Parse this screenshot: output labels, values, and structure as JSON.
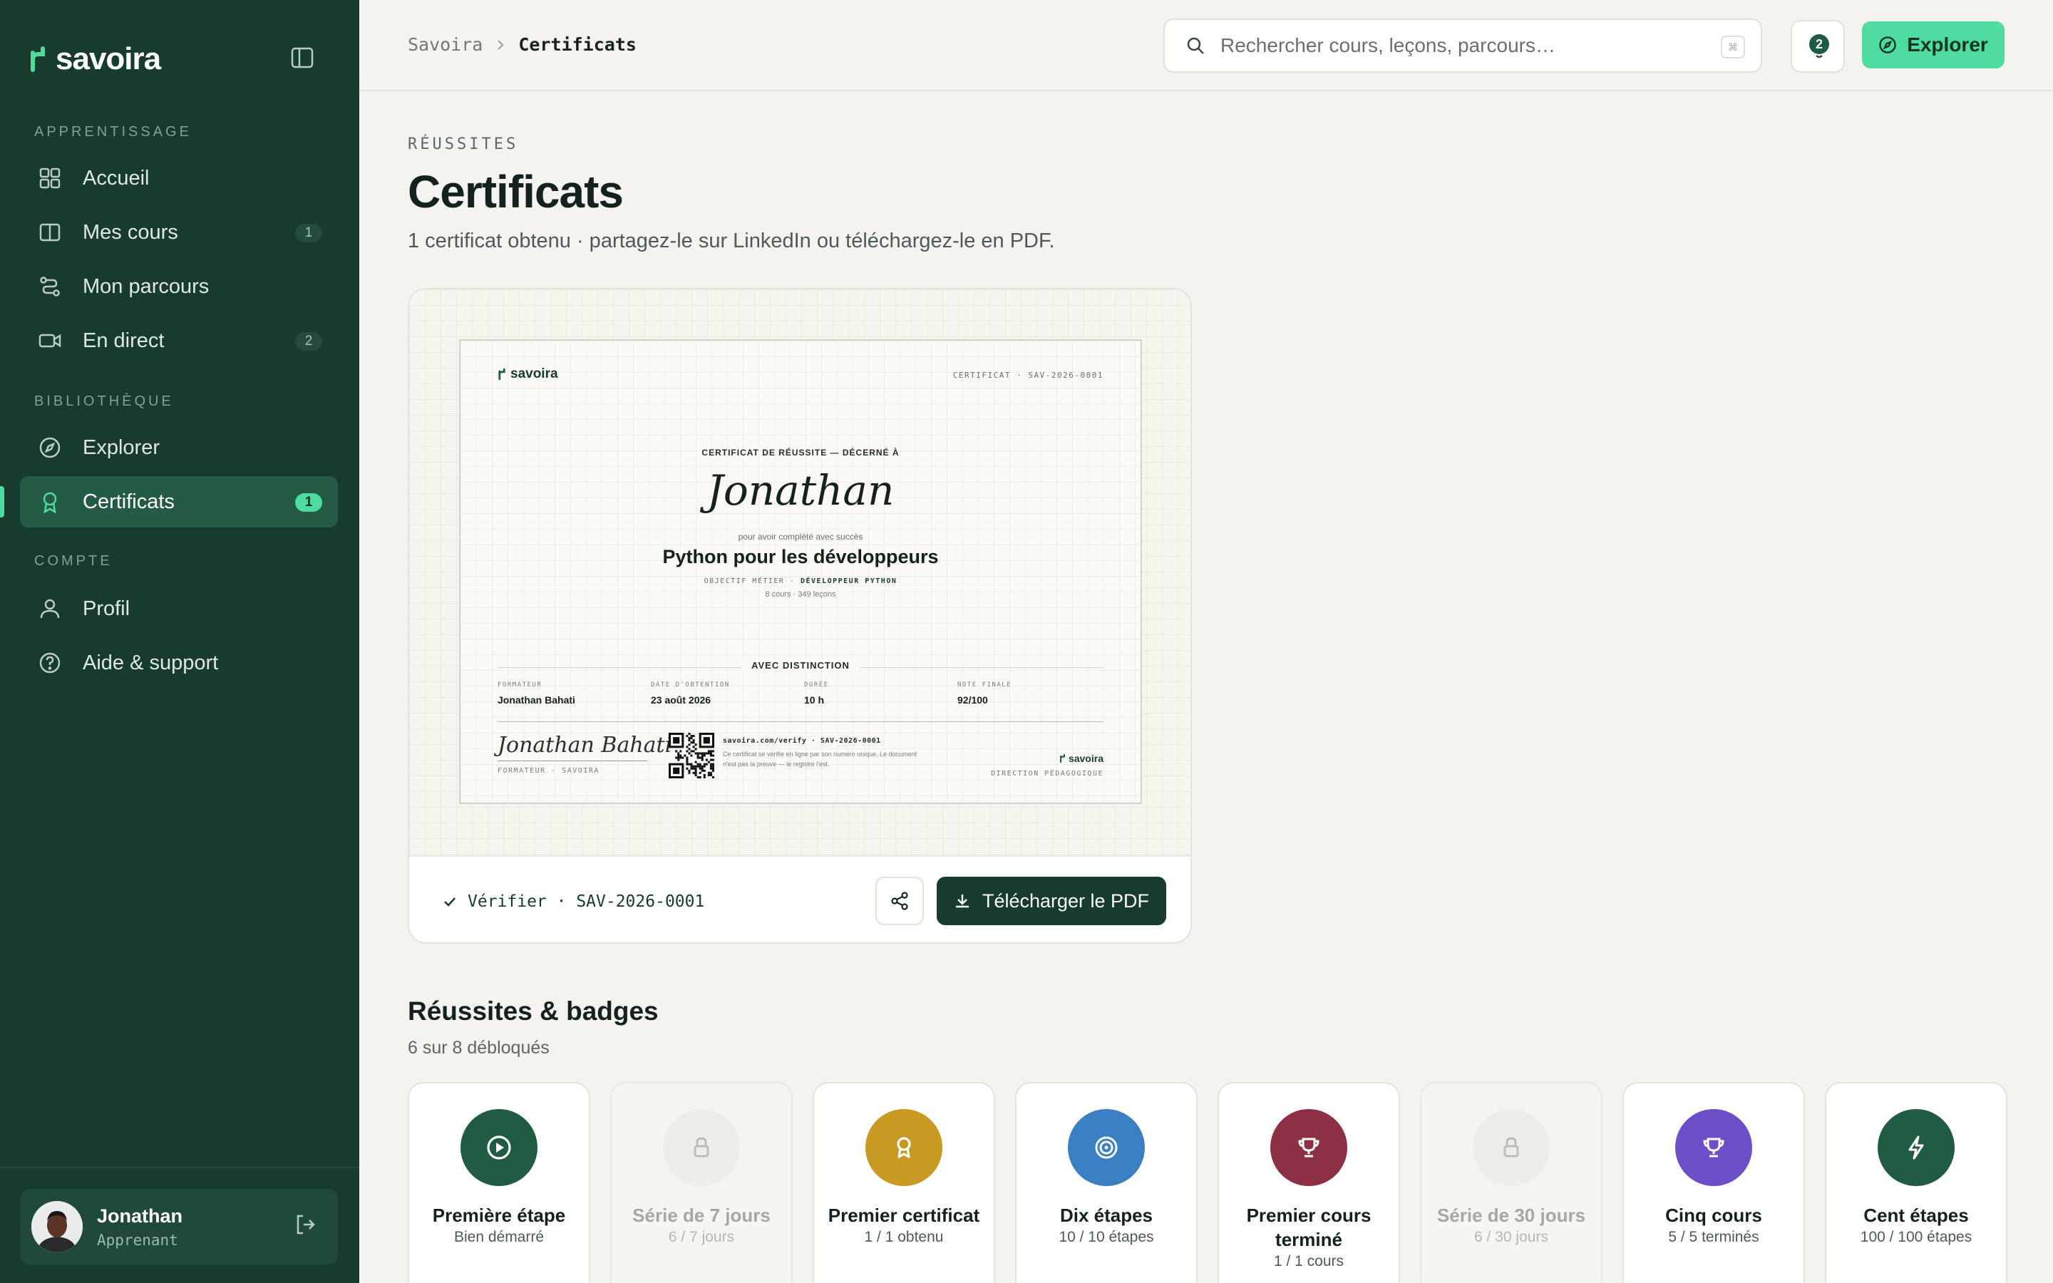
{
  "app": {
    "brand": "savoira"
  },
  "sidebar": {
    "sections": [
      {
        "label": "APPRENTISSAGE"
      },
      {
        "label": "BIBLIOTHÈQUE"
      },
      {
        "label": "COMPTE"
      }
    ],
    "items": [
      {
        "label": "Accueil",
        "icon": "grid-icon"
      },
      {
        "label": "Mes cours",
        "icon": "book-icon",
        "count": "1"
      },
      {
        "label": "Mon parcours",
        "icon": "route-icon"
      },
      {
        "label": "En direct",
        "icon": "video-icon",
        "count": "2"
      },
      {
        "label": "Explorer",
        "icon": "compass-icon"
      },
      {
        "label": "Certificats",
        "icon": "award-icon",
        "count": "1",
        "active": true
      },
      {
        "label": "Profil",
        "icon": "user-icon"
      },
      {
        "label": "Aide & support",
        "icon": "help-icon"
      }
    ],
    "user": {
      "name": "Jonathan",
      "role": "Apprenant"
    }
  },
  "topbar": {
    "breadcrumb": {
      "parent": "Savoira",
      "current": "Certificats"
    },
    "search_placeholder": "Rechercher cours, leçons, parcours…",
    "notifications": "2",
    "explore_label": "Explorer"
  },
  "page": {
    "eyebrow": "RÉUSSITES",
    "title": "Certificats",
    "subtitle": "1 certificat obtenu · partagez-le sur LinkedIn ou téléchargez-le en PDF."
  },
  "certificate": {
    "brand": "savoira",
    "id_label": "CERTIFICAT · SAV-2026-0001",
    "awarded": "CERTIFICAT DE RÉUSSITE — DÉCERNÉ À",
    "name": "Jonathan",
    "completed": "pour avoir complété avec succès",
    "course": "Python pour les développeurs",
    "goal_label": "OBJECTIF MÉTIER ·",
    "goal_value": "DÉVELOPPEUR PYTHON",
    "meta": "8 cours · 349 leçons",
    "distinction": "AVEC DISTINCTION",
    "fields": [
      {
        "label": "FORMATEUR",
        "value": "Jonathan Bahati"
      },
      {
        "label": "DATE D'OBTENTION",
        "value": "23 août 2026"
      },
      {
        "label": "DURÉE",
        "value": "10 h"
      },
      {
        "label": "NOTE FINALE",
        "value": "92/100"
      }
    ],
    "signature": "Jonathan Bahati",
    "signature_label": "FORMATEUR · SAVOIRA",
    "verify_url": "savoira.com/verify · SAV-2026-0001",
    "verify_note": "Ce certificat se vérifie en ligne par son numéro unique. Le document n'est pas la preuve — le registre l'est.",
    "direction_label": "DIRECTION PÉDAGOGIQUE",
    "footer_verify": "Vérifier · SAV-2026-0001",
    "download_label": "Télécharger le PDF"
  },
  "badges_section": {
    "title": "Réussites & badges",
    "subtitle": "6 sur 8 débloqués",
    "items": [
      {
        "title": "Première étape",
        "sub": "Bien démarré",
        "color": "#1f5c43",
        "icon": "play-icon",
        "locked": false
      },
      {
        "title": "Série de 7 jours",
        "sub": "6 / 7 jours",
        "color": "#efede8",
        "icon": "lock-icon",
        "locked": true
      },
      {
        "title": "Premier certificat",
        "sub": "1 / 1 obtenu",
        "color": "#c99a22",
        "icon": "award-icon",
        "locked": false
      },
      {
        "title": "Dix étapes",
        "sub": "10 / 10 étapes",
        "color": "#3a7fc4",
        "icon": "target-icon",
        "locked": false
      },
      {
        "title": "Premier cours terminé",
        "sub": "1 / 1 cours",
        "color": "#8d2f45",
        "icon": "trophy-icon",
        "locked": false
      },
      {
        "title": "Série de 30 jours",
        "sub": "6 / 30 jours",
        "color": "#efede8",
        "icon": "lock-icon",
        "locked": true
      },
      {
        "title": "Cinq cours",
        "sub": "5 / 5 terminés",
        "color": "#6a4fc8",
        "icon": "trophy-icon",
        "locked": false
      },
      {
        "title": "Cent étapes",
        "sub": "100 / 100 étapes",
        "color": "#1f5c43",
        "icon": "bolt-icon",
        "locked": false
      }
    ]
  }
}
